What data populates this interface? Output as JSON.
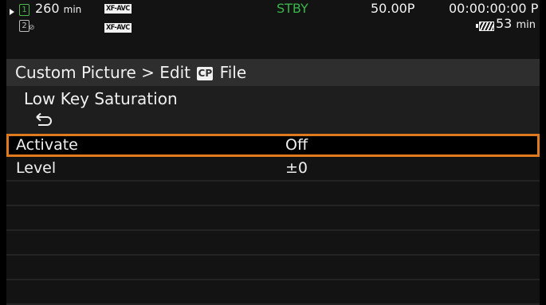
{
  "status_bar": {
    "slot1_label": "1",
    "slot2_label": "2",
    "slot2_glyph": "⊘",
    "remaining_time": "260",
    "remaining_unit": "min",
    "format_slot1": "XF-AVC",
    "format_slot2": "XF-AVC",
    "mode": "STBY",
    "frame_rate": "50.00P",
    "timecode": "00:00:00:00 P",
    "battery_time": "53",
    "battery_unit": "min",
    "colors": {
      "standby": "#39b54a",
      "slot_active": "#4cb84c",
      "cursor": "#e07a1e"
    }
  },
  "breadcrumb": {
    "prefix": "Custom Picture > Edit ",
    "icon_label": "CP",
    "suffix": " File"
  },
  "page": {
    "title": "Low Key Saturation",
    "back_icon": "return-arrow-icon"
  },
  "menu": {
    "items": [
      {
        "label": "Activate",
        "value": "Off",
        "selected": true
      },
      {
        "label": "Level",
        "value": "±0",
        "selected": false
      }
    ]
  }
}
